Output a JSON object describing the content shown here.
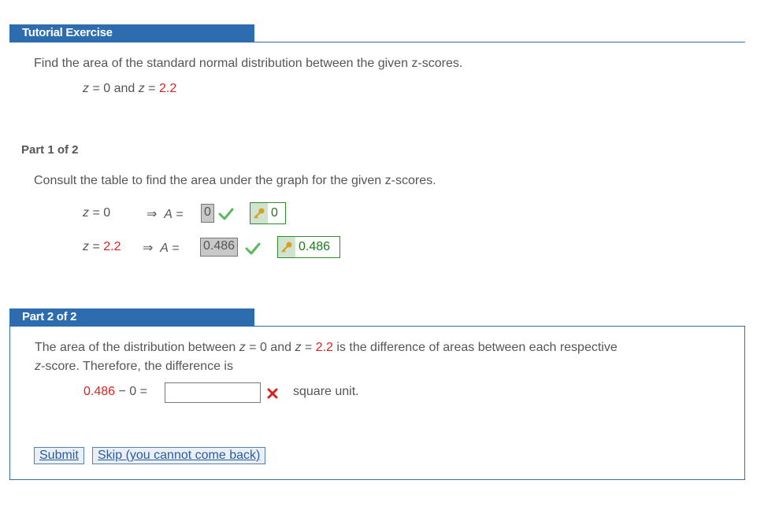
{
  "header": {
    "title": "Tutorial Exercise"
  },
  "intro": {
    "instruction": "Find the area of the standard normal distribution between the given z-scores.",
    "z_var": "z",
    "eq": " = ",
    "z1": "0",
    "and": " and ",
    "z2": "2.2"
  },
  "part1": {
    "label": "Part 1 of 2",
    "instruction": "Consult the table to find the area under the graph for the given z-scores.",
    "rows": [
      {
        "z_label": "z",
        "eq": " = ",
        "z_value": "0",
        "arrow": "⇒",
        "a_label": "A",
        "a_eq": " = ",
        "answer": "0",
        "key_value": "0"
      },
      {
        "z_label": "z",
        "eq": " = ",
        "z_value": "2.2",
        "arrow": "⇒",
        "a_label": "A",
        "a_eq": " = ",
        "answer": "0.486",
        "key_value": "0.486"
      }
    ]
  },
  "part2": {
    "label": "Part 2 of 2",
    "text1_a": "The area of the distribution between ",
    "text1_z": "z",
    "text1_b": " = 0 and ",
    "text1_z2": "z",
    "text1_c": " = ",
    "text1_val": "2.2",
    "text1_d": " is the difference of areas between each respective",
    "text2_z": "z",
    "text2_b": "-score. Therefore, the difference is",
    "expr_a": "0.486",
    "expr_minus": " − ",
    "expr_b": "0",
    "expr_eq": " =",
    "input_value": "",
    "unit": "square unit.",
    "submit_label": "Submit",
    "skip_label": "Skip (you cannot come back)"
  },
  "colors": {
    "accent": "#2e6cb0",
    "red": "#e02020",
    "green": "#1f7a1f"
  }
}
